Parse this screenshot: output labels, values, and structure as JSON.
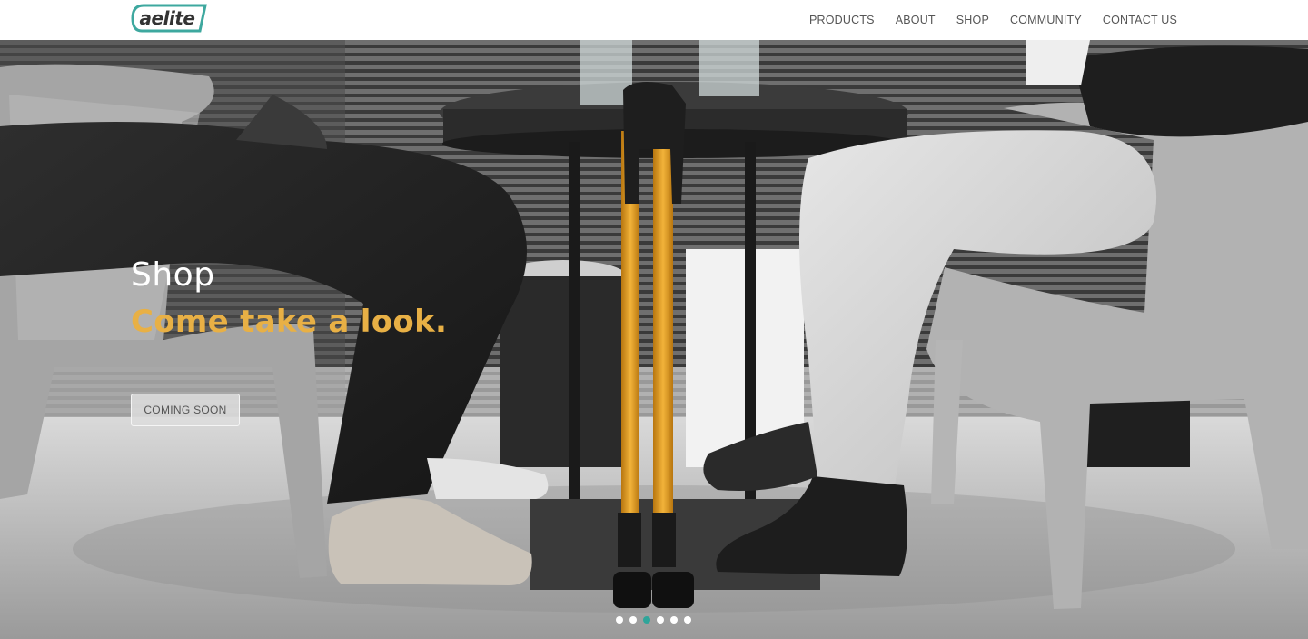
{
  "header": {
    "logo_text": "aelite",
    "nav": [
      {
        "label": "PRODUCTS"
      },
      {
        "label": "ABOUT"
      },
      {
        "label": "SHOP"
      },
      {
        "label": "COMMUNITY"
      },
      {
        "label": "CONTACT US"
      }
    ]
  },
  "hero": {
    "title": "Shop",
    "subtitle": "Come take a look.",
    "cta_label": "COMING SOON",
    "slider": {
      "count": 6,
      "active_index": 2
    }
  },
  "colors": {
    "accent_teal": "#2fa59a",
    "subtitle_gold": "#e8b045",
    "cane_orange": "#e09a1a"
  }
}
